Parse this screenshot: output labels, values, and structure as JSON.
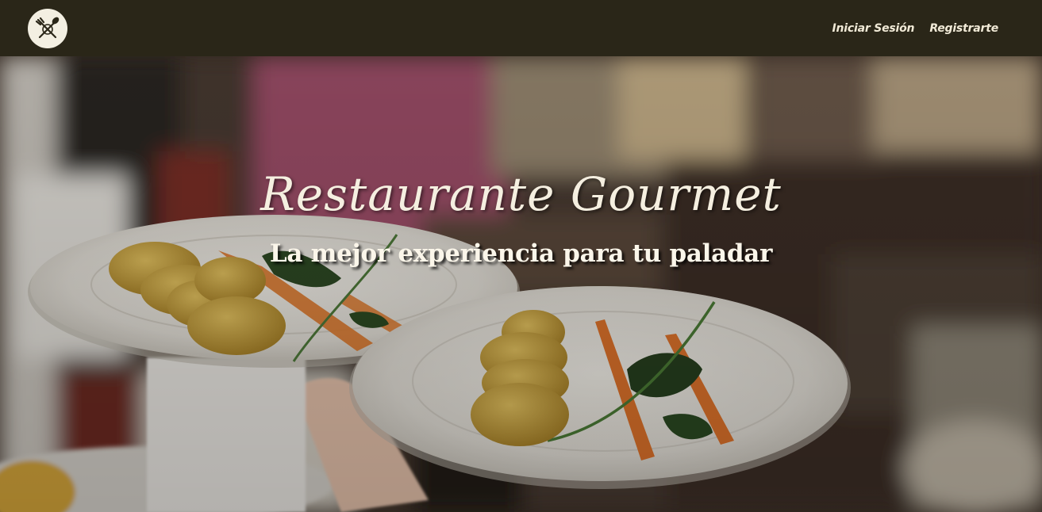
{
  "nav": {
    "logo_icon": "crossed-fork-spoon-logo-icon",
    "links": [
      {
        "label": "Iniciar Sesión"
      },
      {
        "label": "Registrarte"
      }
    ]
  },
  "hero": {
    "title": "Restaurante Gourmet",
    "subtitle": "La mejor experiencia para tu paladar",
    "background": "restaurant-plates-photo"
  },
  "colors": {
    "navbar": "#2a2618",
    "text": "#f1ead7",
    "logo_bg": "#f3efe2"
  }
}
